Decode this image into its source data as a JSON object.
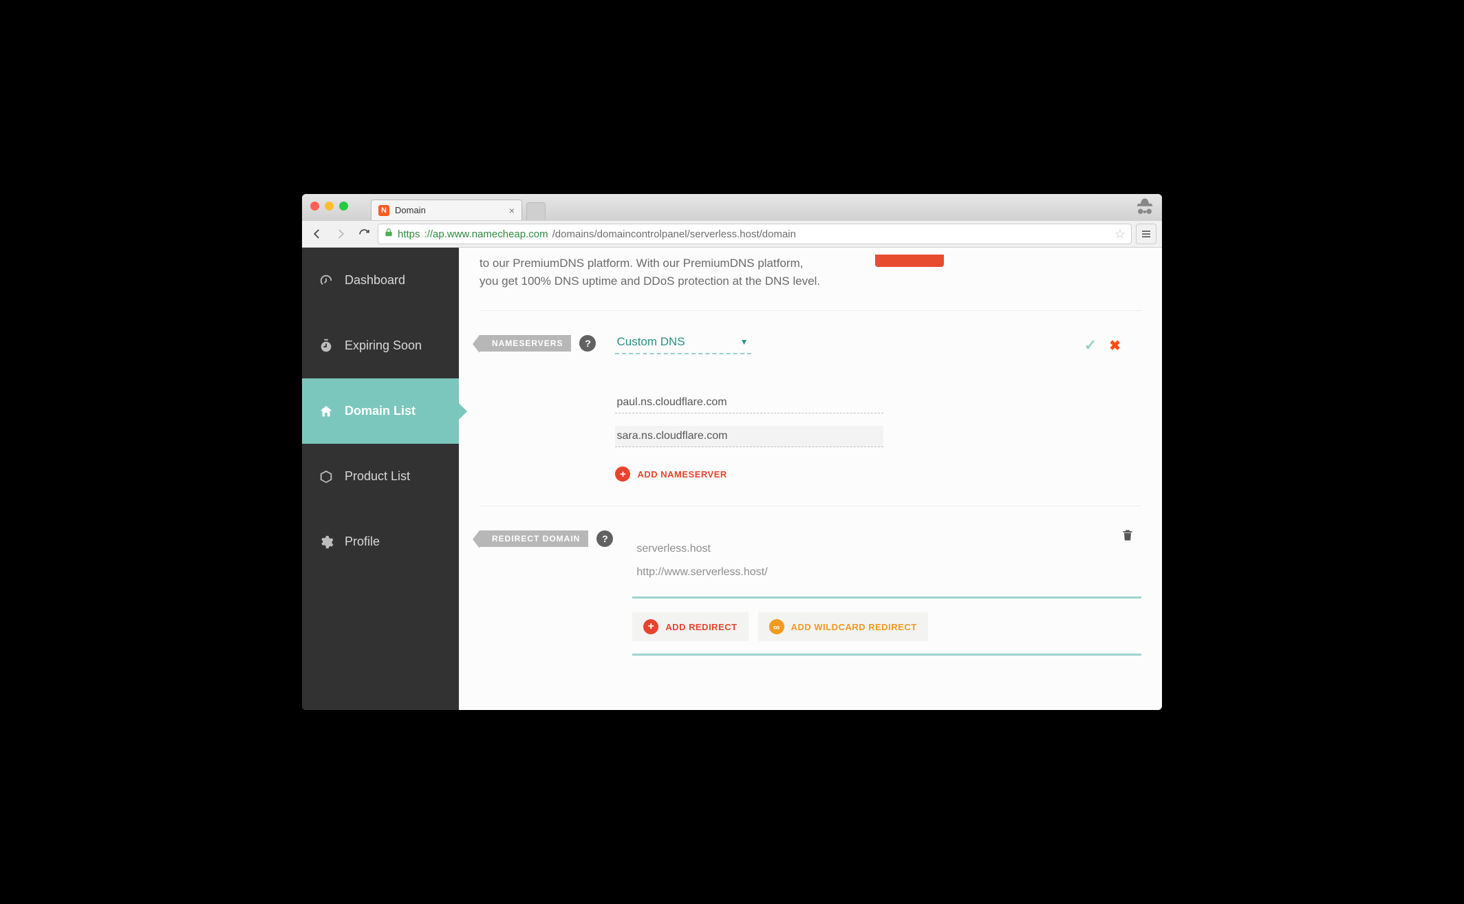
{
  "browser": {
    "tab_title": "Domain",
    "url_scheme": "https",
    "url_host": "://ap.www.namecheap.com",
    "url_path": "/domains/domaincontrolpanel/serverless.host/domain"
  },
  "sidebar": {
    "items": [
      {
        "label": "Dashboard"
      },
      {
        "label": "Expiring Soon"
      },
      {
        "label": "Domain List"
      },
      {
        "label": "Product List"
      },
      {
        "label": "Profile"
      }
    ]
  },
  "info": {
    "line1": "to our PremiumDNS platform. With our PremiumDNS platform,",
    "line2": "you get 100% DNS uptime and DDoS protection at the DNS level."
  },
  "nameservers": {
    "ribbon": "NAMESERVERS",
    "dropdown_label": "Custom DNS",
    "entries": [
      "paul.ns.cloudflare.com",
      "sara.ns.cloudflare.com"
    ],
    "add_label": "ADD NAMESERVER"
  },
  "redirect": {
    "ribbon": "REDIRECT DOMAIN",
    "source": "serverless.host",
    "target": "http://www.serverless.host/",
    "add_redirect_label": "ADD REDIRECT",
    "add_wildcard_label": "ADD WILDCARD REDIRECT"
  }
}
